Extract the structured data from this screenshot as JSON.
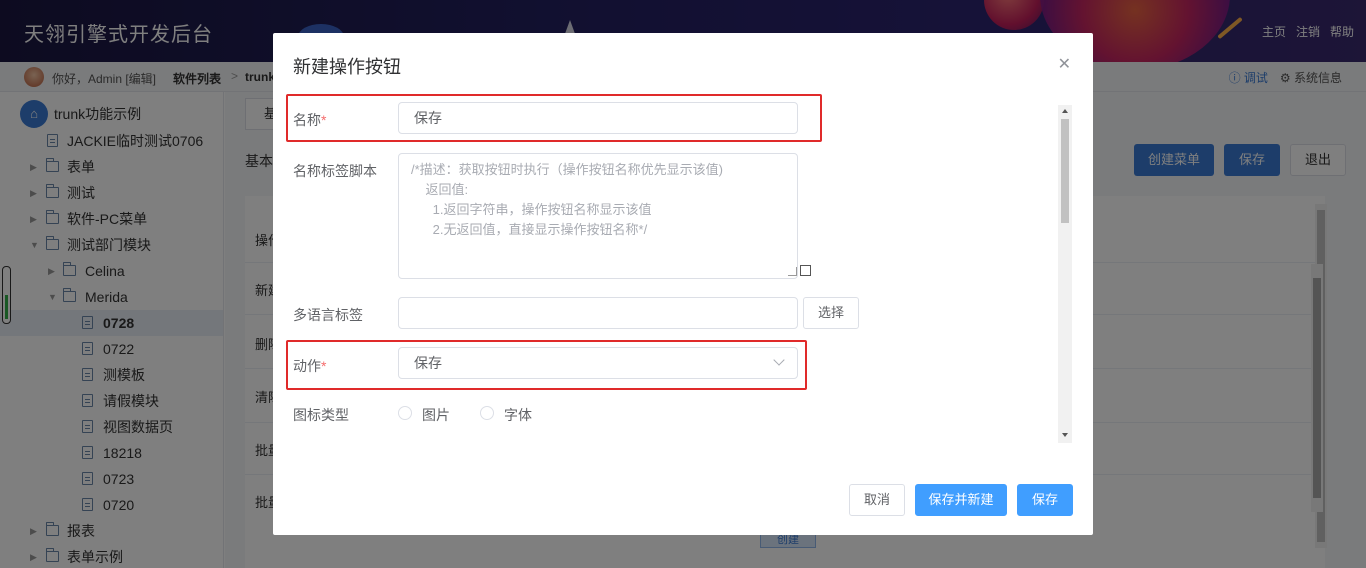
{
  "header": {
    "app_title": "天翎引擎式开发后台",
    "links": [
      "主页",
      "注销",
      "帮助"
    ]
  },
  "breadcrumb": {
    "greeting": "你好，Admin [编辑]",
    "item1": "软件列表",
    "separator": ">",
    "item2": "trunk",
    "debug": "ⓘ 调试",
    "system_info": "⚙ 系统信息"
  },
  "sidebar": {
    "root": "trunk功能示例",
    "items": [
      {
        "label": "JACKIE临时测试0706",
        "kind": "file"
      },
      {
        "label": "表单",
        "kind": "folder"
      },
      {
        "label": "测试",
        "kind": "folder"
      },
      {
        "label": "软件-PC菜单",
        "kind": "folder"
      },
      {
        "label": "测试部门模块",
        "kind": "folder-open"
      },
      {
        "label": "Celina",
        "kind": "folder"
      },
      {
        "label": "Merida",
        "kind": "folder-open"
      },
      {
        "label": "0728",
        "kind": "file",
        "selected": true
      },
      {
        "label": "0722",
        "kind": "file"
      },
      {
        "label": "测模板",
        "kind": "file"
      },
      {
        "label": "请假模块",
        "kind": "file"
      },
      {
        "label": "视图数据页",
        "kind": "file"
      },
      {
        "label": "18218",
        "kind": "file"
      },
      {
        "label": "0723",
        "kind": "file"
      },
      {
        "label": "0720",
        "kind": "file"
      },
      {
        "label": "报表",
        "kind": "folder"
      },
      {
        "label": "表单示例",
        "kind": "folder"
      }
    ]
  },
  "main": {
    "tab_label": "基",
    "section_label": "基本",
    "create_menu": "创建菜单",
    "save": "保存",
    "exit": "退出",
    "rows": [
      "操作",
      "新建",
      "删除",
      "清除",
      "批量",
      "批量"
    ],
    "create_btn": "创建"
  },
  "modal": {
    "title": "新建操作按钮",
    "close": "✕",
    "name_label": "名称",
    "required": "*",
    "name_value": "保存",
    "script_label": "名称标签脚本",
    "script_value": "/*描述：获取按钮时执行（操作按钮名称优先显示该值)\n    返回值:\n      1.返回字符串，操作按钮名称显示该值\n      2.无返回值，直接显示操作按钮名称*/",
    "i18n_label": "多语言标签",
    "i18n_value": "",
    "select_btn": "选择",
    "action_label": "动作",
    "action_value": "保存",
    "icon_type_label": "图标类型",
    "icon_opt1": "图片",
    "icon_opt2": "字体",
    "cancel": "取消",
    "save_and_new": "保存并新建",
    "save": "保存"
  },
  "colors": {
    "primary": "#409eff",
    "highlight": "#e02a2a",
    "required": "#f56c6c"
  }
}
